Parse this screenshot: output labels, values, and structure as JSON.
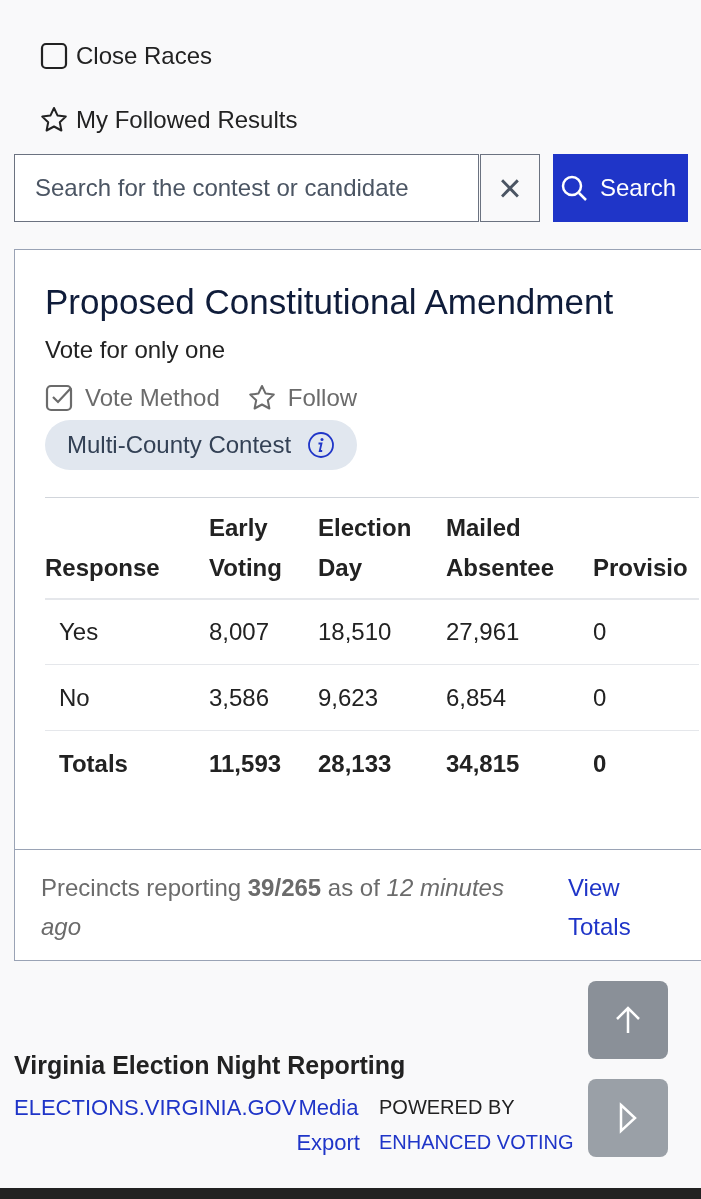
{
  "filters": [
    {
      "kind": "checkbox",
      "label": "Close Races",
      "checked": false
    },
    {
      "kind": "star",
      "label": "My Followed Results",
      "checked": false
    }
  ],
  "search": {
    "placeholder": "Search for the contest or candidate",
    "clear": "×",
    "button": "Search"
  },
  "contest": {
    "title": "Proposed Constitutional Amendment",
    "subtitle": "Vote for only one",
    "actions": [
      {
        "kind": "checkbox",
        "label": "Vote Method",
        "checked": true
      },
      {
        "kind": "star",
        "label": "Follow",
        "checked": false
      }
    ],
    "badge": "Multi-County Contest",
    "table": {
      "columns": [
        "Response",
        "Early Voting",
        "Election Day",
        "Mailed Absentee",
        "Provisio"
      ],
      "rows": [
        {
          "total": false,
          "cells": [
            "Yes",
            "8,007",
            "18,510",
            "27,961",
            "0"
          ]
        },
        {
          "total": false,
          "cells": [
            "No",
            "3,586",
            "9,623",
            "6,854",
            "0"
          ]
        },
        {
          "total": true,
          "cells": [
            "Totals",
            "11,593",
            "28,133",
            "34,815",
            "0"
          ]
        }
      ]
    },
    "status": "Precincts reporting **39/265** as of *12 minutes ago*",
    "link": "View Totals"
  },
  "footer": {
    "title": "Virginia Election Night Reporting",
    "links": [
      "ELECTIONS.VIRGINIA.GOV",
      "Media Export"
    ],
    "powered": "POWERED BY",
    "powered_link": "ENHANCED VOTING"
  }
}
